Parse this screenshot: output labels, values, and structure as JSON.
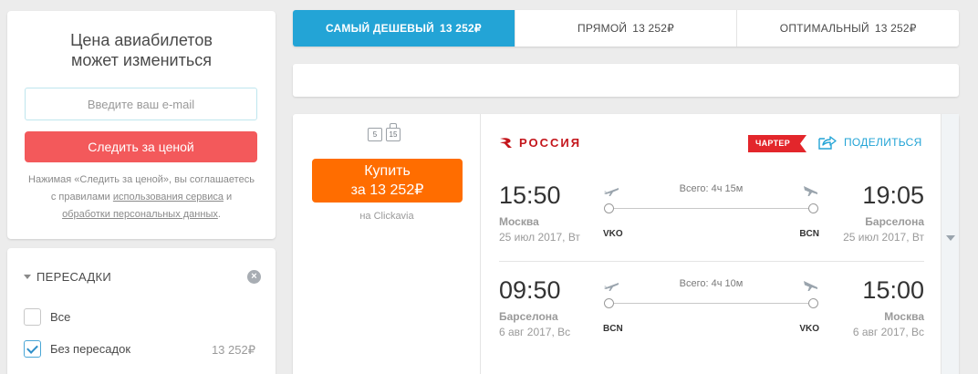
{
  "price_alert": {
    "title_line1": "Цена авиабилетов",
    "title_line2": "может измениться",
    "email_placeholder": "Введите ваш e-mail",
    "button": "Следить за ценой",
    "consent_text_1": "Нажимая «Следить за ценой», вы соглашаетесь с правилами ",
    "consent_link_1": "использования сервиса",
    "consent_text_2": " и ",
    "consent_link_2": "обработки персональных данных",
    "consent_text_3": "."
  },
  "filters": {
    "title": "ПЕРЕСАДКИ",
    "clear_icon": "clear-x-icon",
    "options": [
      {
        "label": "Все",
        "checked": false,
        "price": ""
      },
      {
        "label": "Без пересадок",
        "checked": true,
        "price": "13 252₽"
      }
    ]
  },
  "tabs": [
    {
      "label": "САМЫЙ ДЕШЕВЫЙ",
      "price": "13 252₽",
      "active": true
    },
    {
      "label": "ПРЯМОЙ",
      "price": "13 252₽",
      "active": false
    },
    {
      "label": "ОПТИМАЛЬНЫЙ",
      "price": "13 252₽",
      "active": false
    }
  ],
  "ticket": {
    "baggage": [
      "5",
      "15"
    ],
    "buy_line1": "Купить",
    "buy_line2": "за 13 252₽",
    "agency": "на Clickavia",
    "airline": "РОССИЯ",
    "charter_badge": "ЧАРТЕР",
    "share": "ПОДЕЛИТЬСЯ",
    "colors": {
      "buy": "#ff6d00",
      "accent": "#23a4d6",
      "airline": "#c4161c",
      "charter": "#e3262b"
    },
    "legs": [
      {
        "dep_time": "15:50",
        "arr_time": "19:05",
        "dep_city": "Москва",
        "arr_city": "Барселона",
        "dep_date": "25 июл 2017, Вт",
        "arr_date": "25 июл 2017, Вт",
        "duration": "Всего: 4ч 15м",
        "dep_code": "VKO",
        "arr_code": "BCN"
      },
      {
        "dep_time": "09:50",
        "arr_time": "15:00",
        "dep_city": "Барселона",
        "arr_city": "Москва",
        "dep_date": "6 авг 2017, Вс",
        "arr_date": "6 авг 2017, Вс",
        "duration": "Всего: 4ч 10м",
        "dep_code": "BCN",
        "arr_code": "VKO"
      }
    ]
  }
}
